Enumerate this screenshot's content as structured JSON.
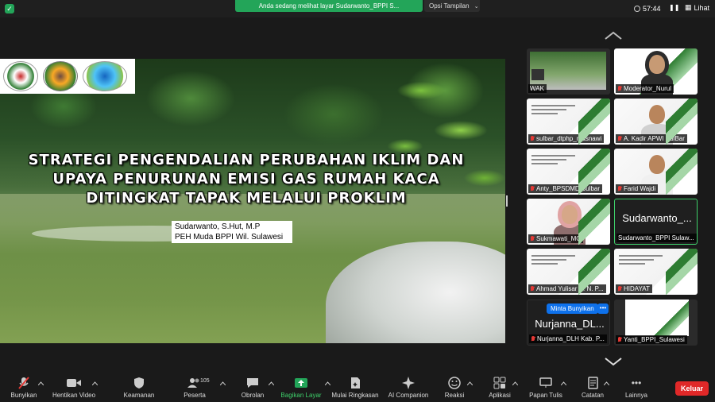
{
  "top_bar": {
    "sharing_banner": "Anda sedang melihat layar Sudarwanto_BPPI S...",
    "view_options": "Opsi Tampilan",
    "timer": "57:44",
    "view_button": "Lihat"
  },
  "slide": {
    "title_lines": [
      "STRATEGI PENGENDALIAN PERUBAHAN IKLIM DAN",
      "UPAYA PENURUNAN EMISI GAS RUMAH KACA",
      "DITINGKAT TAPAK MELALUI PROKLIM"
    ],
    "presenter_lines": [
      "Sudarwanto, S.Hut, M.P",
      "PEH Muda BPPI Wil. Sulawesi"
    ]
  },
  "gallery": {
    "tiles": [
      {
        "name": "WAK",
        "muted": false
      },
      {
        "name": "Moderator_Nurul",
        "muted": true
      },
      {
        "name": "sulbar_dtphp_masnawi",
        "muted": true
      },
      {
        "name": "A. Kadir APWI SulBar",
        "muted": true
      },
      {
        "name": "Anty_BPSDMD Sulbar",
        "muted": true
      },
      {
        "name": "Farid Wajdi",
        "muted": true
      },
      {
        "name": "Sukmawati_MC",
        "muted": true
      },
      {
        "name": "Sudarwanto_BPPI Sulaw...",
        "big_name": "Sudarwanto_...",
        "muted": false
      },
      {
        "name": "Ahmad Yulisar B. N. P...",
        "muted": true
      },
      {
        "name": "HIDAYAT",
        "muted": true
      },
      {
        "name": "Nurjanna_DLH Kab. P...",
        "big_name": "Nurjanna_DL...",
        "muted": true
      },
      {
        "name": "Yanti_BPPI_Sulawesi",
        "muted": true
      }
    ],
    "request_unmute": "Minta Bunyikan",
    "more": "•••"
  },
  "toolbar": {
    "unmute": "Bunyikan",
    "stop_video": "Hentikan Video",
    "security": "Keamanan",
    "participants": "Peserta",
    "participants_count": "105",
    "chat": "Obrolan",
    "share_screen": "Bagikan Layar",
    "summary": "Mulai Ringkasan",
    "companion": "AI Companion",
    "reactions": "Reaksi",
    "apps": "Aplikasi",
    "whiteboard": "Papan Tulis",
    "notes": "Catatan",
    "more": "Lainnya",
    "leave": "Keluar"
  },
  "colors": {
    "accent_green": "#23a559",
    "leave_red": "#e02828",
    "request_blue": "#0e71eb"
  }
}
